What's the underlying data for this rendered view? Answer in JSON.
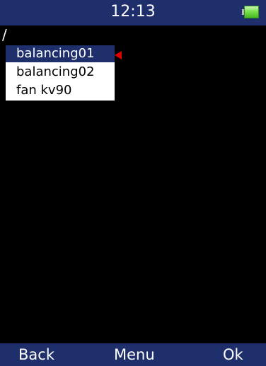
{
  "status_bar": {
    "time": "12:13",
    "battery_icon": "battery-full-icon",
    "battery_level": 1.0
  },
  "path": {
    "text": "/"
  },
  "list": {
    "items": [
      {
        "label": "balancing01",
        "selected": true
      },
      {
        "label": "balancing02",
        "selected": false
      },
      {
        "label": "fan kv90",
        "selected": false
      }
    ],
    "selection_marker_icon": "red-left-arrow-icon",
    "marker_color": "#e10000"
  },
  "softkeys": {
    "left": "Back",
    "center": "Menu",
    "right": "Ok"
  },
  "colors": {
    "bar_bg": "#1f2f6c",
    "screen_bg": "#000000",
    "list_bg": "#ffffff",
    "selected_bg": "#1f2f6c"
  }
}
